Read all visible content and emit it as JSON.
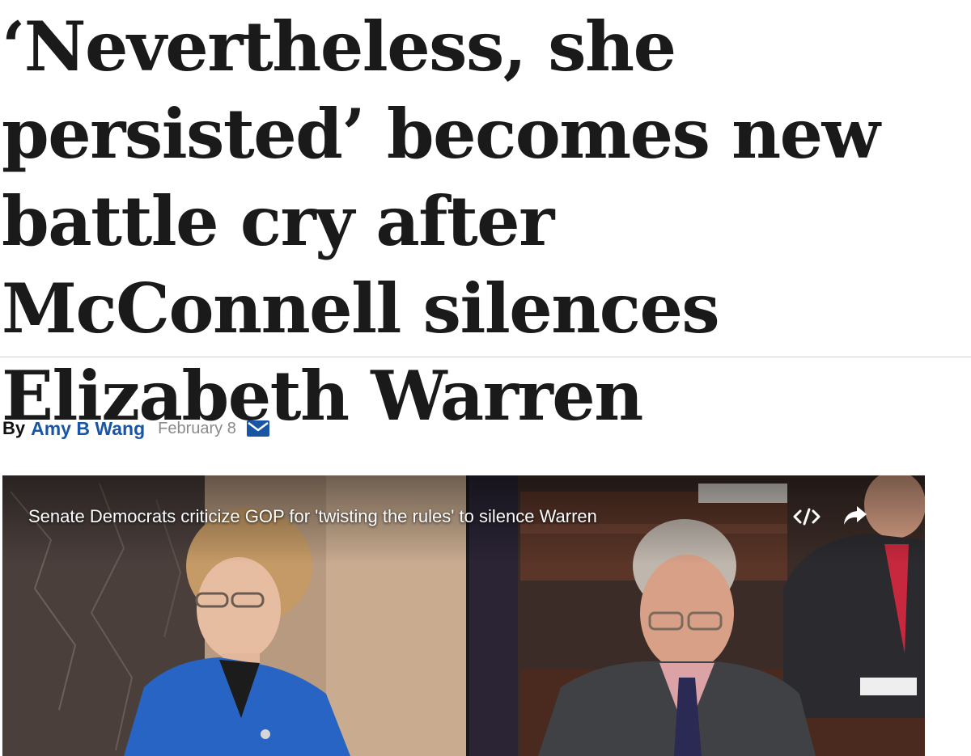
{
  "article": {
    "headline": "‘Nevertheless, she persisted’ becomes new battle cry after McConnell silences Elizabeth Warren"
  },
  "byline": {
    "by_label": "By",
    "author": "Amy B Wang",
    "date": "February 8"
  },
  "video": {
    "title": "Senate Democrats criticize GOP for 'twisting the rules' to silence Warren"
  },
  "icons": {
    "mail": "mail-icon",
    "embed": "embed-code-icon",
    "share": "share-arrow-icon"
  },
  "colors": {
    "headline": "#1a1a1a",
    "author_link": "#1955a5",
    "date": "#8a8a8a",
    "mail_icon": "#1955a5"
  }
}
